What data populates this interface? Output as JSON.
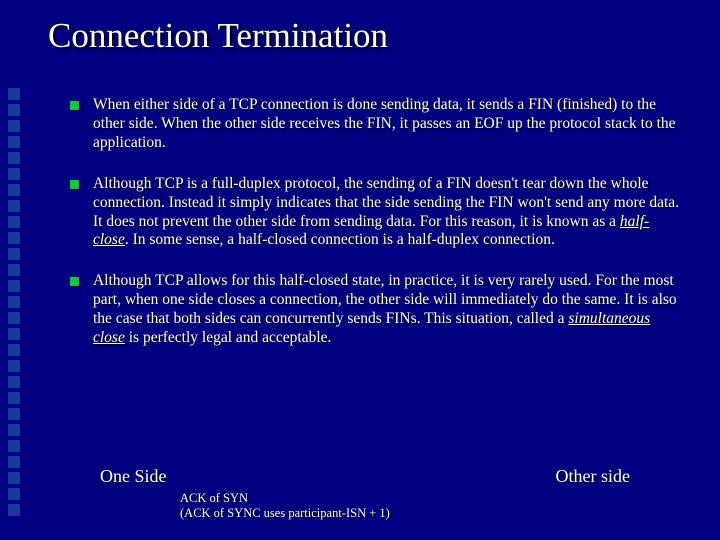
{
  "title": "Connection Termination",
  "bullets": [
    "When either side of a TCP connection is done sending data, it sends a FIN (finished) to the other side. When the other side receives the FIN, it passes an EOF up the protocol stack to the application.",
    "Although TCP is a full-duplex protocol, the sending of a FIN doesn't tear down the whole connection. Instead it simply indicates that the side sending the FIN won't send any more data. It does not prevent the other side from sending data. For this reason, it is known as a <i>half-close</i>. In some sense, a half-closed connection is a half-duplex connection.",
    "Although TCP allows for this half-closed state, in practice, it is very rarely used. For the most part, when one side closes a connection, the other side will immediately do the same. It is also the case that both sides can concurrently sends FINs. This situation, called a <i>simultaneous close</i> is perfectly legal and acceptable."
  ],
  "footer": {
    "left": "One Side",
    "right": "Other side",
    "sub1": "ACK of SYN",
    "sub2": "(ACK of SYNC uses participant-ISN + 1)"
  }
}
